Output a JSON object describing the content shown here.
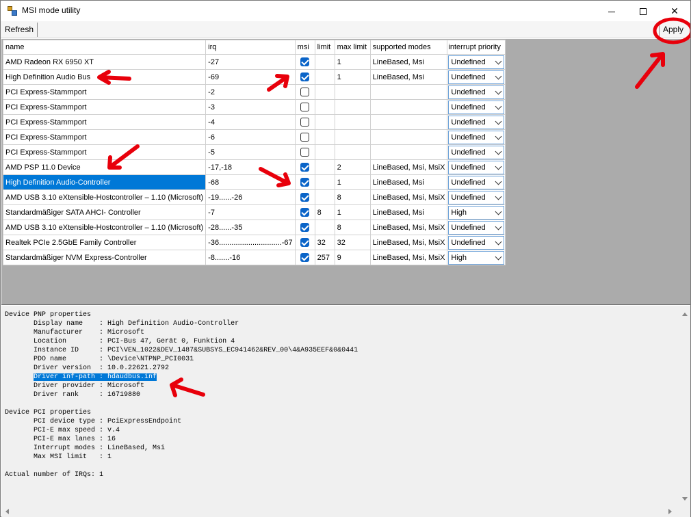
{
  "window": {
    "title": "MSI mode utility",
    "icon": "app-icon"
  },
  "toolbar": {
    "refresh_label": "Refresh",
    "apply_label": "Apply"
  },
  "grid": {
    "headers": [
      "name",
      "irq",
      "msi",
      "limit",
      "max limit",
      "supported modes",
      "interrupt priority"
    ],
    "rows": [
      {
        "name": "AMD Radeon RX 6950 XT",
        "irq": "-27",
        "msi": true,
        "limit": "",
        "max_limit": "1",
        "modes": "LineBased, Msi",
        "priority": "Undefined"
      },
      {
        "name": "High Definition Audio Bus",
        "irq": "-69",
        "msi": true,
        "limit": "",
        "max_limit": "1",
        "modes": "LineBased, Msi",
        "priority": "Undefined"
      },
      {
        "name": "PCI Express-Stammport",
        "irq": "-2",
        "msi": false,
        "limit": "",
        "max_limit": "",
        "modes": "",
        "priority": "Undefined"
      },
      {
        "name": "PCI Express-Stammport",
        "irq": "-3",
        "msi": false,
        "limit": "",
        "max_limit": "",
        "modes": "",
        "priority": "Undefined"
      },
      {
        "name": "PCI Express-Stammport",
        "irq": "-4",
        "msi": false,
        "limit": "",
        "max_limit": "",
        "modes": "",
        "priority": "Undefined"
      },
      {
        "name": "PCI Express-Stammport",
        "irq": "-6",
        "msi": false,
        "limit": "",
        "max_limit": "",
        "modes": "",
        "priority": "Undefined"
      },
      {
        "name": "PCI Express-Stammport",
        "irq": "-5",
        "msi": false,
        "limit": "",
        "max_limit": "",
        "modes": "",
        "priority": "Undefined"
      },
      {
        "name": "AMD PSP 11.0 Device",
        "irq": "-17,-18",
        "msi": true,
        "limit": "",
        "max_limit": "2",
        "modes": "LineBased, Msi, MsiX",
        "priority": "Undefined"
      },
      {
        "name": "High Definition Audio-Controller",
        "irq": "-68",
        "msi": true,
        "limit": "",
        "max_limit": "1",
        "modes": "LineBased, Msi",
        "priority": "Undefined",
        "selected": true
      },
      {
        "name": "AMD USB 3.10 eXtensible-Hostcontroller – 1.10 (Microsoft)",
        "irq": "-19......-26",
        "msi": true,
        "limit": "",
        "max_limit": "8",
        "modes": "LineBased, Msi, MsiX",
        "priority": "Undefined"
      },
      {
        "name": "Standardmäßiger SATA AHCI- Controller",
        "irq": "-7",
        "msi": true,
        "limit": "8",
        "max_limit": "1",
        "modes": "LineBased, Msi",
        "priority": "High"
      },
      {
        "name": "AMD USB 3.10 eXtensible-Hostcontroller – 1.10 (Microsoft)",
        "irq": "-28......-35",
        "msi": true,
        "limit": "",
        "max_limit": "8",
        "modes": "LineBased, Msi, MsiX",
        "priority": "Undefined"
      },
      {
        "name": "Realtek PCIe 2.5GbE Family Controller",
        "irq": "-36..............................-67",
        "msi": true,
        "limit": "32",
        "max_limit": "32",
        "modes": "LineBased, Msi, MsiX",
        "priority": "Undefined"
      },
      {
        "name": "Standardmäßiger NVM Express-Controller",
        "irq": "-8.......-16",
        "msi": true,
        "limit": "257",
        "max_limit": "9",
        "modes": "LineBased, Msi, MsiX",
        "priority": "High"
      }
    ]
  },
  "properties": {
    "pnp_title": "Device PNP properties",
    "pnp": [
      {
        "key": "Display name   ",
        "value": "High Definition Audio-Controller"
      },
      {
        "key": "Manufacturer   ",
        "value": "Microsoft"
      },
      {
        "key": "Location       ",
        "value": "PCI-Bus 47, Gerät 0, Funktion 4"
      },
      {
        "key": "Instance ID    ",
        "value": "PCI\\VEN_1022&DEV_1487&SUBSYS_EC941462&REV_00\\4&A935EEF&0&0441"
      },
      {
        "key": "PDO name       ",
        "value": "\\Device\\NTPNP_PCI0031"
      },
      {
        "key": "Driver version ",
        "value": "10.0.22621.2792"
      },
      {
        "key": "Driver inf-path",
        "value": "hdaudbus.inf",
        "highlighted": true
      },
      {
        "key": "Driver provider",
        "value": "Microsoft"
      },
      {
        "key": "Driver rank    ",
        "value": "16719880"
      }
    ],
    "pci_title": "Device PCI properties",
    "pci": [
      {
        "key": "PCI device type",
        "value": "PciExpressEndpoint"
      },
      {
        "key": "PCI-E max speed",
        "value": "v.4"
      },
      {
        "key": "PCI-E max lanes",
        "value": "16"
      },
      {
        "key": "Interrupt modes",
        "value": "LineBased, Msi"
      },
      {
        "key": "Max MSI limit  ",
        "value": "1"
      }
    ],
    "footer": "Actual number of IRQs: 1"
  },
  "colors": {
    "selection": "#0078d7",
    "annotation": "#e8000b",
    "checkbox_on": "#0a64c8"
  }
}
